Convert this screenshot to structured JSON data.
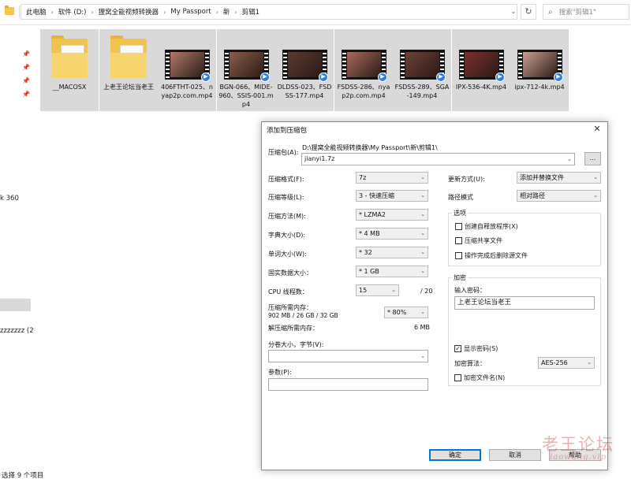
{
  "explorer": {
    "breadcrumb": [
      "此电脑",
      "软件 (D:)",
      "狸窝全能视频转换器",
      "My Passport",
      "新",
      "剪辑1"
    ],
    "search_placeholder": "搜索\"剪辑1\"",
    "nav_k360": "k 360",
    "nav_zzz": "zzzzzzz (2",
    "status": "选择 9 个项目",
    "files": [
      {
        "name": "__MACOSX",
        "icon": "zip-folder-icon"
      },
      {
        "name": "上老王论坛当老王",
        "icon": "zip-folder-icon"
      },
      {
        "name": "406FTHT-025、nyap2p.com.mp4",
        "icon": "video-thumbnail",
        "tone": "#b07a68"
      },
      {
        "name": "BGN-066、MIDE-960、SSIS-001.mp4",
        "icon": "video-thumbnail",
        "tone": "#8a5e4a"
      },
      {
        "name": "DLDSS-023、FSDSS-177.mp4",
        "icon": "video-thumbnail",
        "tone": "#5a3a30"
      },
      {
        "name": "FSDSS-286、nyap2p.com.mp4",
        "icon": "video-thumbnail",
        "tone": "#a86b5c"
      },
      {
        "name": "FSDSS-289、SGA-149.mp4",
        "icon": "video-thumbnail",
        "tone": "#6e4136"
      },
      {
        "name": "IPX-536-4K.mp4",
        "icon": "video-thumbnail",
        "tone": "#7b2f2f"
      },
      {
        "name": "ipx-712-4k.mp4",
        "icon": "video-thumbnail",
        "tone": "#c9a092"
      }
    ]
  },
  "dialog": {
    "title": "添加到压缩包",
    "archive_label": "压缩包(A):",
    "archive_path": "D:\\狸窝全能视频转换器\\My Passport\\新\\剪辑1\\",
    "archive_name": "jianyi1.7z",
    "browse_label": "...",
    "format_label": "压缩格式(F):",
    "format_value": "7z",
    "level_label": "压缩等级(L):",
    "level_value": "3 - 快速压缩",
    "method_label": "压缩方法(M):",
    "method_value": "* LZMA2",
    "dict_label": "字典大小(D):",
    "dict_value": "* 4 MB",
    "word_label": "单词大小(W):",
    "word_value": "* 32",
    "solid_label": "固实数据大小：",
    "solid_value": "* 1 GB",
    "cpu_label": "CPU 线程数：",
    "cpu_value": "15",
    "cpu_max": "/ 20",
    "mem_label": "压缩所需内存：",
    "mem_detail": "902 MB / 26 GB / 32 GB",
    "mem_value": "* 80%",
    "decomp_label": "解压缩所需内存：",
    "decomp_value": "6 MB",
    "split_label": "分卷大小，字节(V):",
    "params_label": "参数(P):",
    "update_label": "更新方式(U):",
    "update_value": "添加并替换文件",
    "path_label": "路径模式",
    "path_value": "相对路径",
    "options_title": "选项",
    "opt_sfx": "创建自释放程序(X)",
    "opt_shared": "压缩共享文件",
    "opt_delete": "操作完成后删除源文件",
    "enc_title": "加密",
    "pwd_label": "输入密码：",
    "pwd_value": "上老王论坛当老王",
    "show_pwd": "显示密码(S)",
    "enc_method_label": "加密算法：",
    "enc_method_value": "AES-256",
    "enc_names": "加密文件名(N)",
    "ok": "确定",
    "cancel": "取消",
    "help": "帮助"
  },
  "watermark": {
    "main": "老王论坛",
    "sub": "laowang.vip"
  }
}
